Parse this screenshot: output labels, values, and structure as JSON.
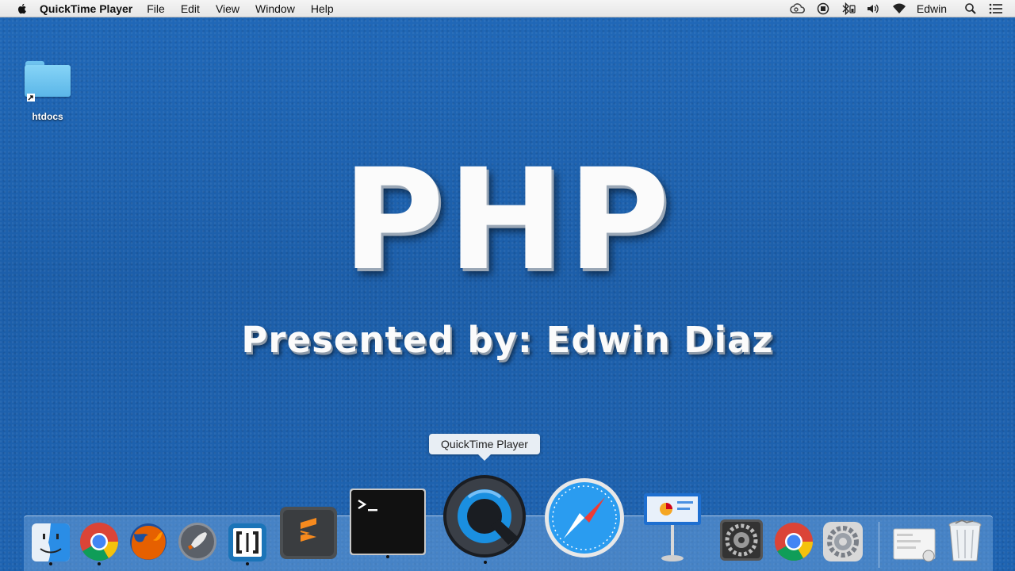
{
  "menubar": {
    "app_name": "QuickTime Player",
    "menus": [
      "File",
      "Edit",
      "View",
      "Window",
      "Help"
    ],
    "status_icons": [
      "creative-cloud-icon",
      "screen-record-icon",
      "bluetooth-icon",
      "volume-icon",
      "wifi-icon"
    ],
    "user": "Edwin"
  },
  "desktop": {
    "items": [
      {
        "label": "htdocs",
        "icon": "folder-alias-icon"
      }
    ]
  },
  "content": {
    "title": "PHP",
    "subtitle": "Presented by: Edwin Diaz"
  },
  "tooltip": {
    "text": "QuickTime Player"
  },
  "dock": {
    "apps": [
      "finder",
      "chrome",
      "firefox",
      "launchpad",
      "brackets",
      "sublime-text",
      "terminal",
      "quicktime-player",
      "safari",
      "keynote",
      "system-preferences",
      "chrome",
      "settings"
    ],
    "stacks": [
      "downloads-stack",
      "trash"
    ]
  },
  "colors": {
    "desktop": "#1f62b0",
    "menubar": "#ececec",
    "title_text": "#fbfbfb"
  }
}
